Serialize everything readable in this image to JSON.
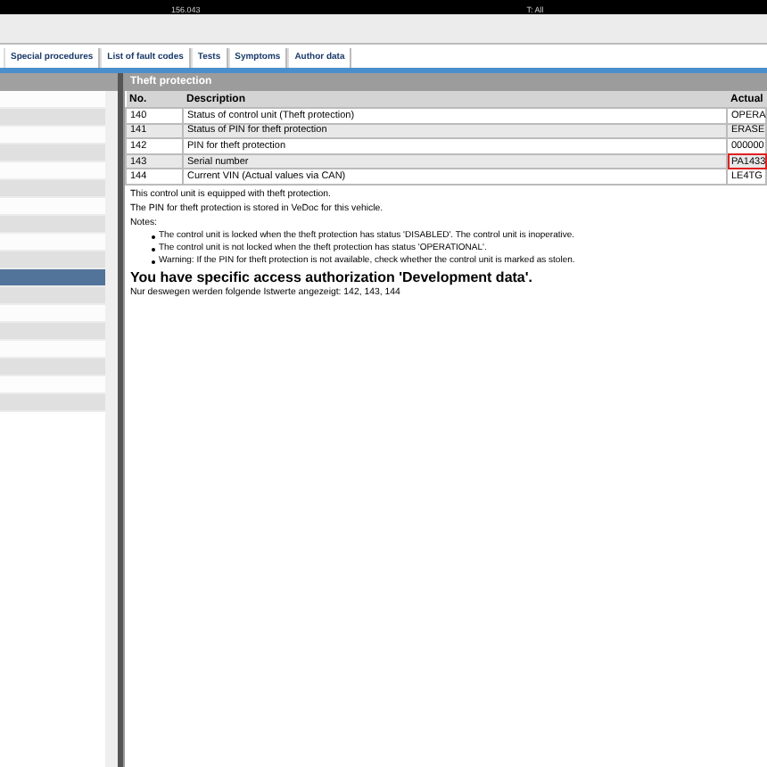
{
  "top_bar": {
    "version": "156.043",
    "filter": "T: All"
  },
  "tabs": [
    {
      "label": "Special procedures",
      "selected": false
    },
    {
      "label": "List of fault codes",
      "selected": false
    },
    {
      "label": "Tests",
      "selected": false
    },
    {
      "label": "Symptoms",
      "selected": false
    },
    {
      "label": "Author data",
      "selected": false
    }
  ],
  "sidebar": {
    "items": [
      {
        "selected": false
      },
      {
        "selected": false
      },
      {
        "selected": false
      },
      {
        "selected": false
      },
      {
        "selected": false
      },
      {
        "selected": false
      },
      {
        "selected": false
      },
      {
        "selected": false
      },
      {
        "selected": false
      },
      {
        "selected": false
      },
      {
        "selected": true
      },
      {
        "selected": false
      },
      {
        "selected": false
      },
      {
        "selected": false
      },
      {
        "selected": false
      },
      {
        "selected": false
      },
      {
        "selected": false
      },
      {
        "selected": false
      }
    ]
  },
  "panel": {
    "title": "Theft protection",
    "table": {
      "columns": [
        "No.",
        "Description",
        "Actual"
      ],
      "rows": [
        {
          "no": "140",
          "description": "Status of control unit (Theft protection)",
          "actual": "OPERA",
          "highlighted": false
        },
        {
          "no": "141",
          "description": "Status of PIN for theft protection",
          "actual": "ERASE",
          "highlighted": false
        },
        {
          "no": "142",
          "description": "PIN for theft protection",
          "actual": "000000",
          "highlighted": false
        },
        {
          "no": "143",
          "description": "Serial number",
          "actual": "PA1433",
          "highlighted": true
        },
        {
          "no": "144",
          "description": "Current VIN (Actual values via CAN)",
          "actual": "LE4TG",
          "highlighted": false
        }
      ]
    },
    "info": [
      "This control unit is equipped with theft protection.",
      "The PIN for theft protection is stored in VeDoc for this vehicle.",
      "Notes:"
    ],
    "notes": [
      "The control unit is locked when the theft protection has status 'DISABLED'. The control unit is inoperative.",
      "The control unit is not locked when the theft protection has status 'OPERATIONAL'.",
      "Warning: If the PIN for theft protection is not available, check whether the control unit is marked as stolen."
    ],
    "heading": "You have specific access authorization 'Development data'.",
    "footer": "Nur deswegen werden folgende Istwerte angezeigt: 142, 143, 144"
  }
}
